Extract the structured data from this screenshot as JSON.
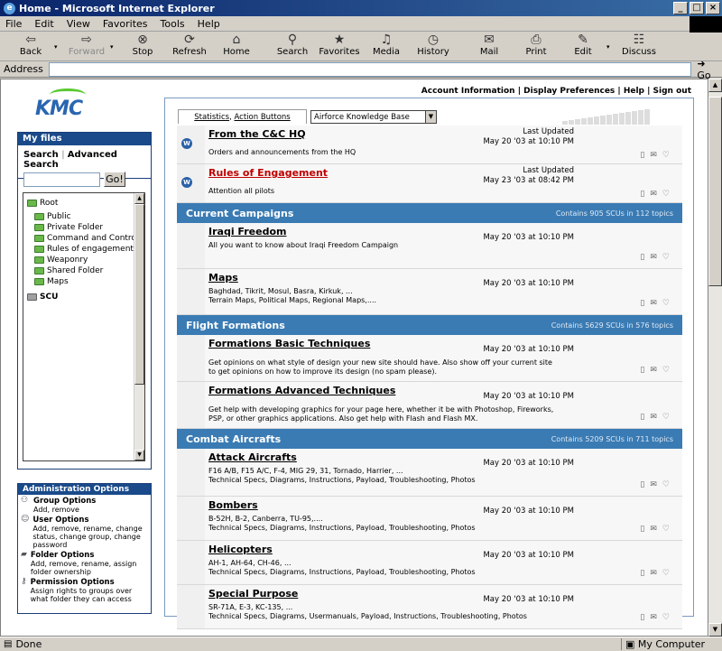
{
  "window": {
    "title": "Home - Microsoft Internet Explorer",
    "controls": [
      "_",
      "□",
      "×"
    ]
  },
  "menu": [
    "File",
    "Edit",
    "View",
    "Favorites",
    "Tools",
    "Help"
  ],
  "toolbar": [
    {
      "label": "Back",
      "icon": "back-arrow-icon",
      "glyph": "⇦"
    },
    {
      "label": "Forward",
      "icon": "forward-arrow-icon",
      "glyph": "⇨"
    },
    {
      "label": "Stop",
      "icon": "stop-icon",
      "glyph": "⊗"
    },
    {
      "label": "Refresh",
      "icon": "refresh-icon",
      "glyph": "⟳"
    },
    {
      "label": "Home",
      "icon": "home-icon",
      "glyph": "⌂"
    },
    {
      "label": "Search",
      "icon": "search-icon",
      "glyph": "⚲"
    },
    {
      "label": "Favorites",
      "icon": "favorites-icon",
      "glyph": "★"
    },
    {
      "label": "Media",
      "icon": "media-icon",
      "glyph": "♫"
    },
    {
      "label": "History",
      "icon": "history-icon",
      "glyph": "◷"
    },
    {
      "label": "Mail",
      "icon": "mail-icon",
      "glyph": "✉"
    },
    {
      "label": "Print",
      "icon": "print-icon",
      "glyph": "⎙"
    },
    {
      "label": "Edit",
      "icon": "edit-icon",
      "glyph": "✎"
    },
    {
      "label": "Discuss",
      "icon": "discuss-icon",
      "glyph": "☷"
    }
  ],
  "address": {
    "label": "Address",
    "value": "",
    "go": "Go"
  },
  "status": {
    "text": "Done",
    "zone": "My Computer"
  },
  "logo": "KMC",
  "top_nav": "Account Information | Display Preferences | Help | Sign out",
  "myfiles": {
    "title": "My files",
    "search": "Search",
    "advanced": "Advanced Search",
    "go": "Go!",
    "tree": {
      "root": "Root",
      "children": [
        "Public",
        "Private Folder",
        "Command and Control",
        "Rules of engagement",
        "Weaponry",
        "Shared Folder",
        "Maps"
      ],
      "scu": "SCU"
    }
  },
  "admin": {
    "title": "Administration Options",
    "items": [
      {
        "title": "Group Options",
        "desc": "Add, remove",
        "icon": "group-icon"
      },
      {
        "title": "User Options",
        "desc": "Add, remove, rename, change status, change group, change password",
        "icon": "user-icon"
      },
      {
        "title": "Folder Options",
        "desc": "Add, remove, rename, assign folder ownership",
        "icon": "folder-icon"
      },
      {
        "title": "Permission Options",
        "desc": "Assign rights to groups over what folder they can access",
        "icon": "key-icon"
      }
    ]
  },
  "tabs": {
    "tab1_a": "Statistics",
    "tab1_b": "Action Buttons",
    "select": "Airforce Knowledge Base"
  },
  "forums": [
    {
      "title": "From the C&C HQ",
      "desc": "Orders and announcements from the HQ",
      "last_label": "Last Updated",
      "date": "May 20 '03 at 10:10 PM"
    },
    {
      "title": "Rules of Engagement",
      "desc": "Attention all pilots",
      "last_label": "Last Updated",
      "date": "May 23 '03 at 08:42 PM"
    }
  ],
  "categories": [
    {
      "name": "Current Campaigns",
      "stats": "Contains 905 SCUs in 112 topics",
      "topics": [
        {
          "title": "Iraqi Freedom",
          "desc": [
            "All you want to know about Iraqi Freedom Campaign"
          ],
          "date": "May 20 '03 at 10:10 PM"
        },
        {
          "title": "Maps",
          "desc": [
            "Baghdad, Tikrit, Mosul, Basra, Kirkuk, ...",
            "Terrain Maps, Political Maps, Regional Maps,...."
          ],
          "date": "May 20 '03 at 10:10 PM"
        }
      ]
    },
    {
      "name": "Flight Formations",
      "stats": "Contains 5629 SCUs in 576 topics",
      "topics": [
        {
          "title": "Formations Basic Techniques",
          "desc": [
            "Get opinions on what style of design your new site should have. Also show off your current site",
            "to get opinions on how to improve its design (no spam please)."
          ],
          "date": "May 20 '03 at 10:10 PM"
        },
        {
          "title": "Formations Advanced Techniques",
          "desc": [
            "Get help with developing graphics for your page here, whether it be with Photoshop, Fireworks,",
            "PSP, or other graphics applications. Also get help with Flash and Flash MX."
          ],
          "date": "May 20 '03 at 10:10 PM"
        }
      ]
    },
    {
      "name": "Combat Aircrafts",
      "stats": "Contains 5209 SCUs in 711 topics",
      "topics": [
        {
          "title": "Attack Aircrafts",
          "desc": [
            "F16 A/B, F15 A/C, F-4, MIG 29, 31, Tornado, Harrier, ...",
            "Technical Specs, Diagrams, Instructions,  Payload, Troubleshooting, Photos"
          ],
          "date": "May 20 '03 at 10:10 PM"
        },
        {
          "title": "Bombers",
          "desc": [
            "B-52H, B-2, Canberra, TU-95,....",
            "Technical Specs, Diagrams, Instructions,  Payload, Troubleshooting, Photos"
          ],
          "date": "May 20 '03 at 10:10 PM"
        },
        {
          "title": "Helicopters",
          "desc": [
            "AH-1, AH-64, CH-46, ...",
            "Technical Specs, Diagrams, Instructions,  Payload, Troubleshooting, Photos"
          ],
          "date": "May 20 '03 at 10:10 PM"
        },
        {
          "title": "Special Purpose",
          "desc": [
            "SR-71A, E-3, KC-135, ...",
            "Technical Specs, Diagrams, Usermanuals, Payload, Instructions, Troubleshooting, Photos"
          ],
          "date": "May 20 '03 at 10:10 PM"
        }
      ]
    }
  ],
  "icons": {
    "doc": "document-icon",
    "mail": "envelope-icon",
    "fav": "heart-icon"
  },
  "colors": {
    "title_bar": "#0a246a",
    "category_bar": "#3a7bb4",
    "panel_header": "#1a4a8a",
    "red_link": "#c00000"
  }
}
